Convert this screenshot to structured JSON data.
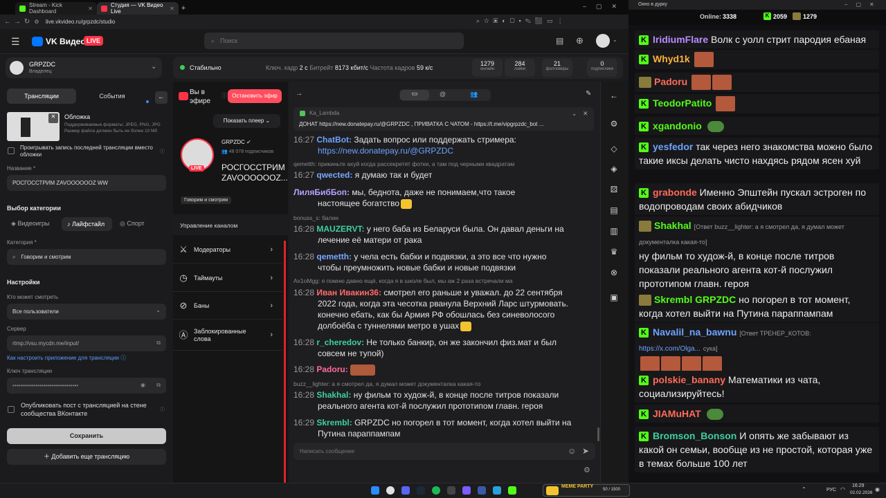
{
  "browser": {
    "tabs": [
      {
        "title": "Stream - Kick Dashboard",
        "color": "#53fc18"
      },
      {
        "title": "Студия — VK Видео Live",
        "color": "#ff3347"
      }
    ],
    "new_tab": "+",
    "url": "live.vkvideo.ru/grpzdc/studio"
  },
  "vk": {
    "logo": "VK Видео",
    "live": "LIVE",
    "search_placeholder": "Поиск"
  },
  "left": {
    "channel_name": "GRPZDC",
    "channel_role": "Владелец",
    "tabs": [
      "Трансляции",
      "События"
    ],
    "cover_title": "Обложка",
    "cover_hint": "Поддерживаемые форматы: JPEG, PNG, JPG Размер файла должен быть не более 10 Мб",
    "replay_checkbox": "Проигрывать запись последней трансляции вместо обложки",
    "title_label": "Название *",
    "title_value": "РОСГОССТРИМ ZAVOOOOOOZ WW",
    "category_section": "Выбор категории",
    "category_tabs": [
      "Видеоигры",
      "Лайфстайл",
      "Спорт"
    ],
    "category_label": "Категория *",
    "category_value": "Говорим и смотрим",
    "settings_section": "Настройки",
    "who_label": "Кто может смотреть",
    "who_value": "Все пользователи",
    "server_label": "Сервер",
    "server_value": "rtmp://vsu.mycdn.me/input/",
    "howto_link": "Как настроить приложение для трансляции",
    "key_label": "Ключ трансляции",
    "key_value": "••••••••••••••••••••••••••••••••••",
    "publish_checkbox": "Опубликовать пост с трансляцией на стене сообщества ВКонтакте",
    "save_button": "Сохранить",
    "add_button": "Добавить еще трансляцию"
  },
  "stats": {
    "status": "Стабильно",
    "keyframe_label": "Ключ. кадр",
    "keyframe_value": "2 с",
    "bitrate_label": "Битрейт",
    "bitrate_value": "8173 кбит/с",
    "fps_label": "Частота кадров",
    "fps_value": "59 к/с",
    "boxes": [
      {
        "num": "1279",
        "label": "онлайн"
      },
      {
        "num": "284",
        "label": "лайки"
      },
      {
        "num": "21",
        "label": "фолловеры"
      },
      {
        "num": "0",
        "label": "подписчики"
      }
    ]
  },
  "middle": {
    "on_air": "Вы в эфире",
    "stop_button": "Остановить эфир",
    "show_player": "Показать плеер",
    "channel": "GRPZDC",
    "subscribers": "48 078 подписчиков",
    "stream_title": "РОСГОССТРИМ ZAVOOOOOOZ...",
    "live_badge": "LIVE",
    "category_tag": "Говорим и смотрим",
    "manage_title": "Управление каналом",
    "menu": [
      "Модераторы",
      "Таймауты",
      "Баны",
      "Заблокированные слова"
    ]
  },
  "chat": {
    "pinned_user": "Ka_Lambda",
    "pinned_text": "ДОНАТ https://new.donatepay.ru/@GRPZDC , ПРИВАТКА С ЧАТОМ - https://t.me/vipgrpzdc_bot ...",
    "input_placeholder": "Написать сообщение",
    "messages": [
      {
        "time": "16:27",
        "user": "ChatBot:",
        "color": "#6fa3ff",
        "text": "Задать вопрос или поддержать стримера:"
      },
      {
        "time": "",
        "user": "",
        "color": "#6fa3ff",
        "text": "https://new.donatepay.ru/@GRPZDC"
      },
      {
        "reply": "qemetth: прикиньте ахуй когда рассекретят фотки, а там под черными квадратам"
      },
      {
        "time": "16:27",
        "user": "qwected:",
        "color": "#7aa8ff",
        "text": "я думаю так и будет"
      },
      {
        "time": "",
        "user": "ЛиляБибБоп:",
        "color": "#b9a2ff",
        "text": "мы, беднота, даже не понимаем,что такое"
      },
      {
        "time": "",
        "user": "",
        "color": "#fff",
        "text": "настоящее богатство"
      },
      {
        "reply": "bonuss_s: балин"
      },
      {
        "time": "16:28",
        "user": "MAUZERVT:",
        "color": "#3fd0a0",
        "text": "у него баба из Беларуси была. Он давал деньги на"
      },
      {
        "time": "",
        "user": "",
        "color": "#fff",
        "text": "лечение её матери от рака"
      },
      {
        "time": "16:28",
        "user": "qemetth:",
        "color": "#7aa8ff",
        "text": "у челa есть бабки и подвязки, а это все что нужно"
      },
      {
        "time": "",
        "user": "",
        "color": "#fff",
        "text": "чтобы преумножить новые бабки и новые подвязки"
      },
      {
        "reply": "Ax1oMgg: я помню давно ещё, когда я в школе был, мы аж 2 раза встречали ма"
      },
      {
        "time": "16:28",
        "user": "Иван Ивакин36:",
        "color": "#ff6b6b",
        "text": "смотрел его раньше и уважал. до 22 сентября"
      },
      {
        "time": "",
        "user": "",
        "color": "#fff",
        "text": "2022 года, когда эта чесотка рванула Верхний Ларс штурмовать."
      },
      {
        "time": "",
        "user": "",
        "color": "#fff",
        "text": "конечно ебать, как бы Армия РФ обошлась без синеволосого"
      },
      {
        "time": "",
        "user": "",
        "color": "#fff",
        "text": "долбоёба с туннелями метро в ушах"
      },
      {
        "time": "16:28",
        "user": "r_cheredov:",
        "color": "#3fd0a0",
        "text": "Не только банкир, он же закончил физ.мат и был"
      },
      {
        "time": "",
        "user": "",
        "color": "#fff",
        "text": "совсем не тупой)"
      },
      {
        "time": "16:28",
        "user": "Padoru:",
        "color": "#ff6b9a",
        "text": ""
      },
      {
        "reply": "buzz__lighter: а я смотрел да, я думал может документалка какая-то"
      },
      {
        "time": "16:28",
        "user": "Shakhal:",
        "color": "#3fd0a0",
        "text": "ну фильм то худож-й, в конце после титров показали"
      },
      {
        "time": "",
        "user": "",
        "color": "#fff",
        "text": "реального агента кот-й послужил прототипом главн. героя"
      },
      {
        "time": "16:29",
        "user": "Skrembl:",
        "color": "#3fd0a0",
        "text": "GRPZDC но погорел в тот момент, когда хотел выйти на"
      },
      {
        "time": "",
        "user": "",
        "color": "#fff",
        "text": "Путина параппампам"
      }
    ]
  },
  "popup": {
    "title": "Окно в дурку",
    "online_label": "Online:",
    "online_value": "3338",
    "kick_count": "2059",
    "vk_count": "1279",
    "messages": [
      {
        "user": "IridiumFlare",
        "color": "#b98cff",
        "text": "Волк с уолл стрит пародия ебаная"
      },
      {
        "user": "Whyd1k",
        "color": "#ffb13b",
        "text": ""
      },
      {
        "user": "Padoru",
        "color": "#ff6b5a",
        "text": ""
      },
      {
        "user": "TeodorPatito",
        "color": "#53fc18",
        "text": ""
      },
      {
        "user": "xgandonio",
        "color": "#53fc18",
        "text": ""
      },
      {
        "user": "yesfedor",
        "color": "#6fa3ff",
        "text": "так через него знакомства можно было такие иксы делать чисто нахдясь рядом ясен хуй"
      },
      {
        "user": "grabonde",
        "color": "#ff6b5a",
        "text": "Именно Эпштейн пускал эстроген по водопроводам своих абидчиков"
      },
      {
        "user": "Shakhal",
        "color": "#53fc18",
        "reply": "[Ответ buzz__lighter: а я смотрел да, я думал может документалка какая-то]",
        "text": "ну фильм то худож-й, в конце после титров показали реального агента кот-й послужил прототипом главн. героя"
      },
      {
        "user": "Skrembl",
        "color": "#53fc18",
        "mention": "GRPZDC",
        "text": "но погорел в тот момент, когда хотел выйти на Путина параппампам"
      },
      {
        "user": "Navalil_na_bawnu",
        "color": "#6fa3ff",
        "reply": "[Ответ ТРЕНЕР_КОТОВ:",
        "link": "https://x.com/Olga...",
        "text": "сука]"
      },
      {
        "user": "polskie_banany",
        "color": "#ff6b5a",
        "text": "Математики из чата, социализируйтесь!"
      },
      {
        "user": "JIAMuHAT",
        "color": "#ff6b5a",
        "text": ""
      },
      {
        "user": "Bromson_Bonson",
        "color": "#3fd0a0",
        "text": "И опять же забывают из какой он семьи, вообще из не простой, которая уже в темах больше 100 лет"
      }
    ]
  },
  "taskbar": {
    "lang": "РУС",
    "time": "16:29",
    "date": "02.02.2026",
    "meme_party": "MEME PARTY",
    "meme_count": "50 / 1500"
  }
}
